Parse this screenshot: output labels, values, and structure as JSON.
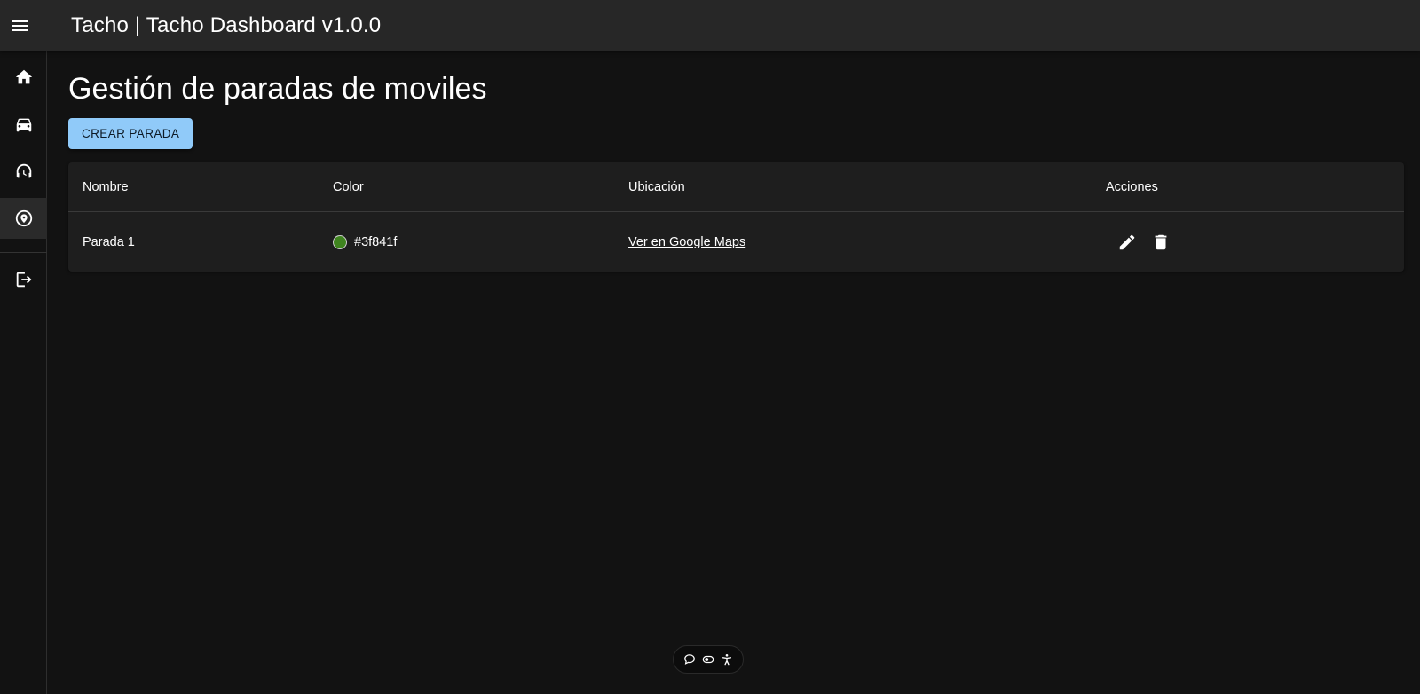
{
  "appbar": {
    "title": "Tacho | Tacho Dashboard v1.0.0",
    "menu_icon": "menu-icon"
  },
  "sidebar": {
    "items": [
      {
        "name": "home",
        "icon": "home-icon",
        "active": false
      },
      {
        "name": "vehicles",
        "icon": "car-icon",
        "active": false
      },
      {
        "name": "support",
        "icon": "headset-icon",
        "active": false
      },
      {
        "name": "stops",
        "icon": "location-icon",
        "active": true
      },
      {
        "name": "logout",
        "icon": "logout-icon",
        "active": false
      }
    ]
  },
  "page": {
    "title": "Gestión de paradas de moviles",
    "create_button": "CREAR PARADA"
  },
  "table": {
    "headers": [
      "Nombre",
      "Color",
      "Ubicación",
      "Acciones"
    ],
    "rows": [
      {
        "name": "Parada 1",
        "color": "#3f841f",
        "location_link": "Ver en Google Maps",
        "actions": [
          "edit-icon",
          "delete-icon"
        ]
      }
    ]
  },
  "floating_toolbar": {
    "icons": [
      "chat-icon",
      "toggle-icon",
      "accessibility-icon"
    ]
  },
  "colors": {
    "background": "#121212",
    "appbar": "#272727",
    "card": "#1e1e1e",
    "primary_button": "#90caf9",
    "row_color_swatch": "#3f841f"
  }
}
